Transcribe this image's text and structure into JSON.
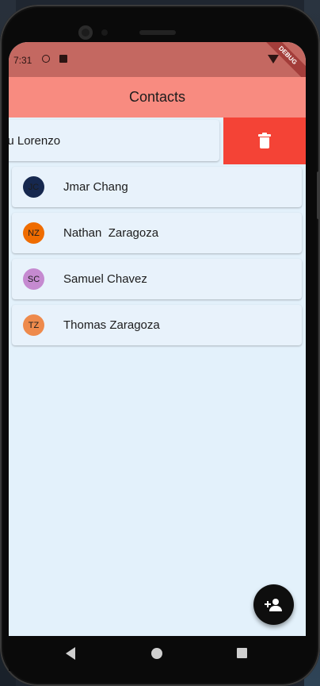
{
  "status_bar": {
    "time": "7:31",
    "debug_label": "DEBUG"
  },
  "app_bar": {
    "title": "Contacts"
  },
  "swiped_item": {
    "name": "nu Lorenzo",
    "action": "delete"
  },
  "contacts": [
    {
      "initials": "JC",
      "name": "Jmar Chang",
      "avatar_color": "#16284f"
    },
    {
      "initials": "NZ",
      "name": "Nathan  Zaragoza",
      "avatar_color": "#ef6c00"
    },
    {
      "initials": "SC",
      "name": "Samuel Chavez",
      "avatar_color": "#c58ad0"
    },
    {
      "initials": "TZ",
      "name": "Thomas Zaragoza",
      "avatar_color": "#ee8a4c"
    }
  ],
  "fab": {
    "icon": "person-add-icon"
  },
  "nav": {
    "back_icon": "back-icon",
    "home_icon": "home-icon",
    "recents_icon": "recents-icon"
  },
  "colors": {
    "app_bar": "#f88b80",
    "status_bar": "#c46861",
    "delete": "#f44336",
    "screen_bg": "#e3f1fb"
  }
}
